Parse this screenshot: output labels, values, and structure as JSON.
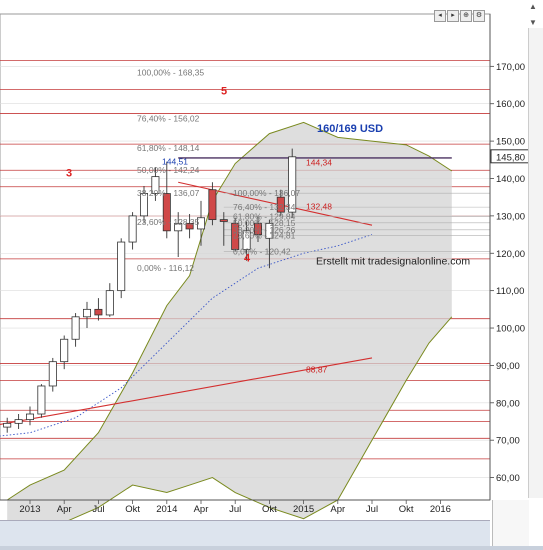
{
  "window": {
    "toolbar_icons": [
      "left-arrow-icon",
      "right-arrow-icon",
      "zoom-icon",
      "settings-icon"
    ],
    "toolbar_glyphs": [
      "◂",
      "▸",
      "⊕",
      "⚙"
    ],
    "scroll_up_glyph": "▲",
    "scroll_down_glyph": "▼"
  },
  "colors": {
    "price_line": "#8b1a1a",
    "bollinger_fill": "#d3d3d3",
    "bollinger_line": "#7a8a1f",
    "fib_line": "#b0b0b0",
    "trend_line": "#d32f2f",
    "current_price_box": "#333333",
    "blue_text": "#1a3fb0",
    "red_text": "#cc2222",
    "candle_up": "#ffffff",
    "candle_down": "#d04848",
    "nav_fill": "#4a8fd8"
  },
  "chart_data": {
    "type": "candlestick",
    "title": "",
    "xlabel": "",
    "ylabel": "",
    "ylim": [
      54,
      184
    ],
    "y_ticks": [
      "170,00",
      "160,00",
      "150,00",
      "140,00",
      "130,00",
      "120,00",
      "110,00",
      "100,00",
      "90,00",
      "80,00",
      "70,00",
      "60,00"
    ],
    "x_ticks": [
      "2013",
      "Apr",
      "Jul",
      "Okt",
      "2014",
      "Apr",
      "Jul",
      "Okt",
      "2015",
      "Apr",
      "Jul",
      "Okt",
      "2016"
    ],
    "current_price_label": "145,80",
    "candles": [
      {
        "month": "2012-11",
        "open": 73.5,
        "high": 76.0,
        "low": 72.0,
        "close": 74.5
      },
      {
        "month": "2012-12",
        "open": 74.5,
        "high": 77.0,
        "low": 73.0,
        "close": 75.5
      },
      {
        "month": "2013-01",
        "open": 75.5,
        "high": 79.0,
        "low": 74.0,
        "close": 77.0
      },
      {
        "month": "2013-02",
        "open": 77.0,
        "high": 85.0,
        "low": 76.0,
        "close": 84.5
      },
      {
        "month": "2013-03",
        "open": 84.5,
        "high": 92.0,
        "low": 83.0,
        "close": 91.0
      },
      {
        "month": "2013-04",
        "open": 91.0,
        "high": 98.0,
        "low": 89.0,
        "close": 97.0
      },
      {
        "month": "2013-05",
        "open": 97.0,
        "high": 104.0,
        "low": 95.0,
        "close": 103.0
      },
      {
        "month": "2013-06",
        "open": 103.0,
        "high": 107.0,
        "low": 100.0,
        "close": 105.0
      },
      {
        "month": "2013-07",
        "open": 105.0,
        "high": 108.0,
        "low": 102.0,
        "close": 103.5
      },
      {
        "month": "2013-08",
        "open": 103.5,
        "high": 112.0,
        "low": 103.0,
        "close": 110.0
      },
      {
        "month": "2013-09",
        "open": 110.0,
        "high": 124.0,
        "low": 108.0,
        "close": 123.0
      },
      {
        "month": "2013-10",
        "open": 123.0,
        "high": 131.0,
        "low": 121.0,
        "close": 130.0
      },
      {
        "month": "2013-11",
        "open": 130.0,
        "high": 138.0,
        "low": 128.0,
        "close": 136.0
      },
      {
        "month": "2013-12",
        "open": 136.0,
        "high": 143.0,
        "low": 134.0,
        "close": 140.5
      },
      {
        "month": "2014-01",
        "open": 136.0,
        "high": 144.5,
        "low": 124.0,
        "close": 126.0
      },
      {
        "month": "2014-02",
        "open": 126.0,
        "high": 131.0,
        "low": 119.0,
        "close": 128.0
      },
      {
        "month": "2014-03",
        "open": 128.0,
        "high": 130.5,
        "low": 124.0,
        "close": 126.5
      },
      {
        "month": "2014-04",
        "open": 126.5,
        "high": 134.0,
        "low": 122.0,
        "close": 129.5
      },
      {
        "month": "2014-05",
        "open": 137.0,
        "high": 139.0,
        "low": 127.5,
        "close": 129.0
      },
      {
        "month": "2014-06",
        "open": 129.0,
        "high": 131.0,
        "low": 122.0,
        "close": 128.5
      },
      {
        "month": "2014-07",
        "open": 128.0,
        "high": 129.5,
        "low": 120.5,
        "close": 121.0
      },
      {
        "month": "2014-08",
        "open": 121.0,
        "high": 128.5,
        "low": 118.0,
        "close": 126.0
      },
      {
        "month": "2014-09",
        "open": 128.0,
        "high": 130.0,
        "low": 123.0,
        "close": 125.0
      },
      {
        "month": "2014-10",
        "open": 124.0,
        "high": 129.0,
        "low": 116.0,
        "close": 128.0
      },
      {
        "month": "2014-11",
        "open": 135.0,
        "high": 137.0,
        "low": 130.0,
        "close": 131.0
      },
      {
        "month": "2014-12",
        "open": 131.0,
        "high": 148.0,
        "low": 129.5,
        "close": 145.8
      }
    ],
    "horizontal_levels": [
      168.35,
      156.02,
      144.34,
      142.24,
      136.07,
      132.48,
      130.0,
      123.0,
      116.12
    ],
    "fib_labels_upper": [
      {
        "text": "100,00% - 168,35",
        "value": 168.35
      },
      {
        "text": "76,40% - 156,02",
        "value": 156.02
      },
      {
        "text": "61,80% - 148,14",
        "value": 148.14
      },
      {
        "text": "50,00% - 142,24",
        "value": 142.24
      },
      {
        "text": "38,20% - 136,07",
        "value": 136.07
      },
      {
        "text": "23,60% - 128,35",
        "value": 128.35
      },
      {
        "text": "0,00% - 116,12",
        "value": 116.12
      }
    ],
    "fib_labels_lower": [
      {
        "text": "100,00% - 136,07",
        "value": 136.07
      },
      {
        "text": "76,40% - 132,34",
        "value": 132.34
      },
      {
        "text": "61,80% - 129,84",
        "value": 129.84
      },
      {
        "text": "50,00% - 128,15",
        "value": 128.15
      },
      {
        "text": "38,20% - 126,26",
        "value": 126.26
      },
      {
        "text": "23,60% - 124,81",
        "value": 124.81
      },
      {
        "text": "0,00% - 120,42",
        "value": 120.42
      }
    ],
    "price_labels": [
      {
        "text": "144,51",
        "value": 144.51,
        "color": "blue"
      },
      {
        "text": "144,34",
        "value": 144.34,
        "color": "red"
      },
      {
        "text": "132,48",
        "value": 132.48,
        "color": "red"
      },
      {
        "text": "88,87",
        "value": 88.87,
        "color": "red"
      }
    ],
    "wave_labels": [
      "5",
      "3",
      "4"
    ],
    "target_text": "160/169 USD",
    "watermark": "Erstellt mit tradesignalonline.com"
  }
}
